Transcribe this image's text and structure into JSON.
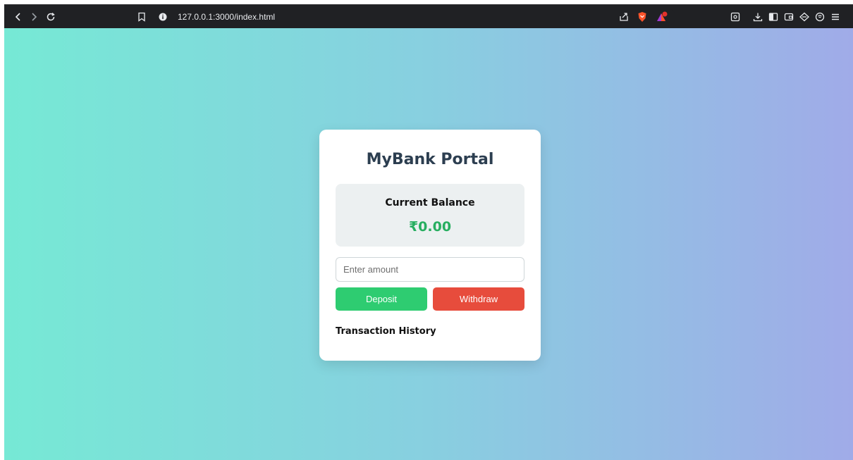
{
  "browser": {
    "url": "127.0.0.1:3000/index.html",
    "icons": [
      "back-icon",
      "forward-icon",
      "reload-icon",
      "bookmark-icon",
      "info-icon",
      "share-icon",
      "brave-shield-icon",
      "brave-rewards-icon",
      "screenshot-icon",
      "download-icon",
      "sidebar-icon",
      "wallet-icon",
      "leo-icon",
      "vpn-icon",
      "menu-icon"
    ]
  },
  "page": {
    "background_start": "#76e9d5",
    "background_end": "#a0abe8"
  },
  "bank": {
    "title": "MyBank Portal",
    "balance_label": "Current Balance",
    "balance_value": "₹0.00",
    "balance_color": "#27ae60",
    "amount_placeholder": "Enter amount",
    "deposit_label": "Deposit",
    "deposit_color": "#2ecc71",
    "withdraw_label": "Withdraw",
    "withdraw_color": "#e74c3c",
    "history_title": "Transaction History",
    "transactions": []
  }
}
